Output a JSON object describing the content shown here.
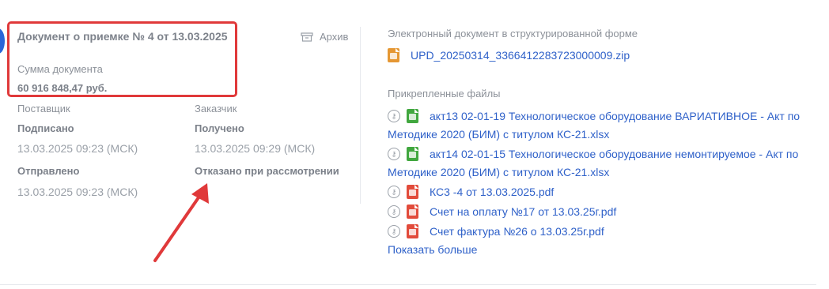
{
  "left": {
    "title": "Документ о приемке № 4 от 13.03.2025",
    "archive_label": "Архив",
    "sum_label": "Сумма документа",
    "sum_value": "60 916 848,47 руб.",
    "supplier": {
      "label": "Поставщик",
      "status1": "Подписано",
      "date1": "13.03.2025 09:23 (МСК)",
      "status2": "Отправлено",
      "date2": "13.03.2025 09:23 (МСК)"
    },
    "customer": {
      "label": "Заказчик",
      "status1": "Получено",
      "date1": "13.03.2025 09:29 (МСК)",
      "status2": "Отказано при рассмотрении"
    }
  },
  "right": {
    "structured_label": "Электронный документ в структурированной форме",
    "structured_file": "UPD_20250314_3366412283723000009.zip",
    "attached_label": "Прикрепленные файлы",
    "files": [
      {
        "line1": "акт13 02-01-19 Технологическое оборудование ВАРИАТИВНОЕ - Акт по",
        "line2": "Методике 2020 (БИМ) с титулом КС-21.xlsx",
        "type": "xls"
      },
      {
        "line1": "акт14 02-01-15 Технологическое оборудование немонтируемое - Акт по",
        "line2": "Методике 2020 (БИМ) с титулом КС-21.xlsx",
        "type": "xls"
      },
      {
        "line1": "КС3 -4 от 13.03.2025.pdf",
        "type": "pdf"
      },
      {
        "line1": "Счет на оплату №17 от 13.03.25г.pdf",
        "type": "pdf"
      },
      {
        "line1": "Счет фактура №26 о 13.03.25г.pdf",
        "type": "pdf"
      }
    ],
    "show_more": "Показать больше"
  },
  "colors": {
    "highlight": "#e0393a",
    "link": "#2f61c9",
    "xls": "#41a73f",
    "pdf": "#e24b3b",
    "zip": "#e59733"
  }
}
